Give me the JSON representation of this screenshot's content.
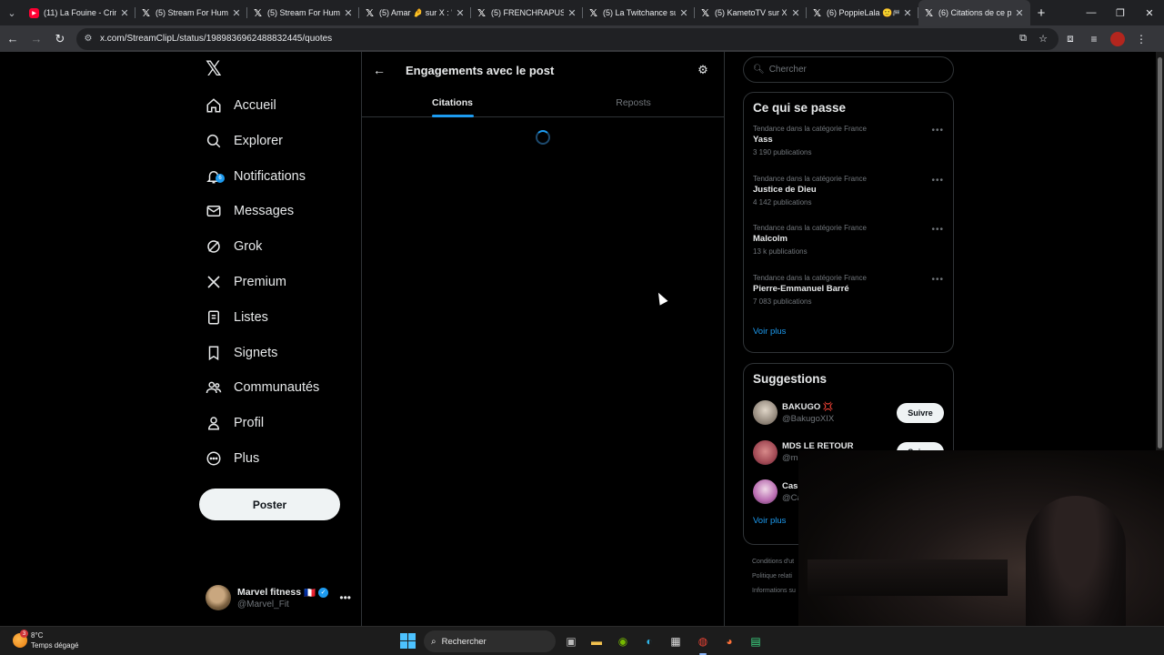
{
  "browser": {
    "tabs": [
      {
        "title": "(11) La Fouine - Crim",
        "favicon": "youtube"
      },
      {
        "title": "(5) Stream For Human",
        "favicon": "x"
      },
      {
        "title": "(5) Stream For Human",
        "favicon": "x"
      },
      {
        "title": "(5) Amar 🤌 sur X : \"(",
        "favicon": "x"
      },
      {
        "title": "(5) FRENCHRAPUS sur",
        "favicon": "x"
      },
      {
        "title": "(5) La Twitchance sur",
        "favicon": "x"
      },
      {
        "title": "(5) KametoTV sur X :",
        "favicon": "x"
      },
      {
        "title": "(6) PoppieLala 🙂🎮",
        "favicon": "x"
      },
      {
        "title": "(6) Citations de ce po",
        "favicon": "x",
        "active": true
      }
    ],
    "url": "x.com/StreamClipL/status/1989836962488832445/quotes"
  },
  "nav": {
    "items": [
      {
        "label": "Accueil",
        "icon": "home-icon"
      },
      {
        "label": "Explorer",
        "icon": "search-icon"
      },
      {
        "label": "Notifications",
        "icon": "bell-icon",
        "badge": "6"
      },
      {
        "label": "Messages",
        "icon": "mail-icon"
      },
      {
        "label": "Grok",
        "icon": "grok-icon"
      },
      {
        "label": "Premium",
        "icon": "x-logo-icon"
      },
      {
        "label": "Listes",
        "icon": "list-icon"
      },
      {
        "label": "Signets",
        "icon": "bookmark-icon"
      },
      {
        "label": "Communautés",
        "icon": "people-icon"
      },
      {
        "label": "Profil",
        "icon": "person-icon"
      },
      {
        "label": "Plus",
        "icon": "more-circle-icon"
      }
    ],
    "post_button": "Poster",
    "account": {
      "name": "Marvel fitness",
      "flag": "🇫🇷",
      "handle": "@Marvel_Fit"
    }
  },
  "main": {
    "title": "Engagements avec le post",
    "tabs": [
      {
        "label": "Citations",
        "active": true
      },
      {
        "label": "Reposts",
        "active": false
      }
    ]
  },
  "right": {
    "search_placeholder": "Chercher",
    "trends_title": "Ce qui se passe",
    "trends": [
      {
        "category": "Tendance dans la catégorie France",
        "name": "Yass",
        "count": "3 190 publications"
      },
      {
        "category": "Tendance dans la catégorie France",
        "name": "Justice de Dieu",
        "count": "4 142 publications"
      },
      {
        "category": "Tendance dans la catégorie France",
        "name": "Malcolm",
        "count": "13 k publications"
      },
      {
        "category": "Tendance dans la catégorie France",
        "name": "Pierre-Emmanuel Barré",
        "count": "7 083 publications"
      }
    ],
    "show_more": "Voir plus",
    "suggestions_title": "Suggestions",
    "suggestions": [
      {
        "name": "BAKUGO 💢",
        "handle": "@BakugoXIX",
        "button": "Suivre"
      },
      {
        "name": "MDS LE RETOUR",
        "handle": "@m",
        "button": "Suivre"
      },
      {
        "name": "Cas",
        "handle": "@Ca",
        "button": ""
      }
    ],
    "footer": [
      "Conditions d'ut",
      "Politique relati",
      "Informations su"
    ]
  },
  "taskbar": {
    "weather_temp": "8°C",
    "weather_desc": "Temps dégagé",
    "weather_badge": "3",
    "search_label": "Rechercher"
  }
}
